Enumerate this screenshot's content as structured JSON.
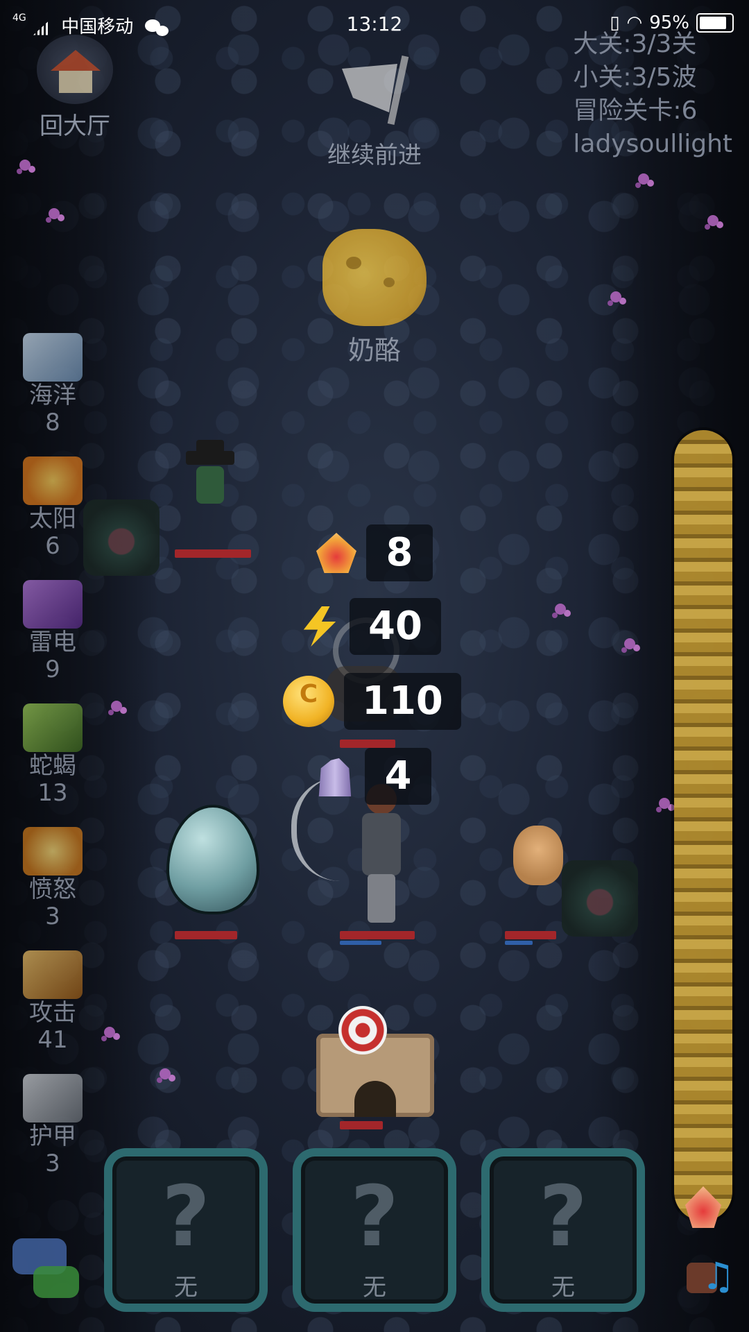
{
  "status_bar": {
    "network": "4G",
    "carrier": "中国移动",
    "time": "13:12",
    "battery": "95%"
  },
  "hall": {
    "label": "回大厅"
  },
  "stage_info": {
    "big_stage": "大关:3/3关",
    "small_stage": "小关:3/5波",
    "adventure_level": "冒险关卡:6",
    "player_name": "ladysoullight"
  },
  "continue": {
    "label": "继续前进"
  },
  "reward_item": {
    "label": "奶酪"
  },
  "elements": [
    {
      "icon": "ocean-icon",
      "name": "海洋",
      "count": "8",
      "color": "#8fb3d6"
    },
    {
      "icon": "sun-icon",
      "name": "太阳",
      "count": "6",
      "color": "#e68a1f"
    },
    {
      "icon": "thunder-icon",
      "name": "雷电",
      "count": "9",
      "color": "#8c4fc4"
    },
    {
      "icon": "scorpion-icon",
      "name": "蛇蝎",
      "count": "13",
      "color": "#6fa23a"
    },
    {
      "icon": "anger-icon",
      "name": "愤怒",
      "count": "3",
      "color": "#e0a030"
    },
    {
      "icon": "sword-icon",
      "name": "攻击",
      "count": "41",
      "color": "#c98c2a"
    },
    {
      "icon": "armor-icon",
      "name": "护甲",
      "count": "3",
      "color": "#9aa0a8"
    }
  ],
  "resources": {
    "gems": "8",
    "energy": "40",
    "gold": "110",
    "crystals": "4"
  },
  "slots": [
    {
      "symbol": "?",
      "label": "无"
    },
    {
      "symbol": "?",
      "label": "无"
    },
    {
      "symbol": "?",
      "label": "无"
    }
  ],
  "health_bars": [
    {
      "name": "hero-hat-hp",
      "hp": 1.0
    },
    {
      "name": "shield-guy-hp",
      "hp": 1.0
    },
    {
      "name": "egg-hp",
      "hp": 1.0
    },
    {
      "name": "archer-hp",
      "hp": 1.0
    },
    {
      "name": "dog-hp",
      "hp": 1.0
    },
    {
      "name": "tower-hp",
      "hp": 1.0
    }
  ]
}
